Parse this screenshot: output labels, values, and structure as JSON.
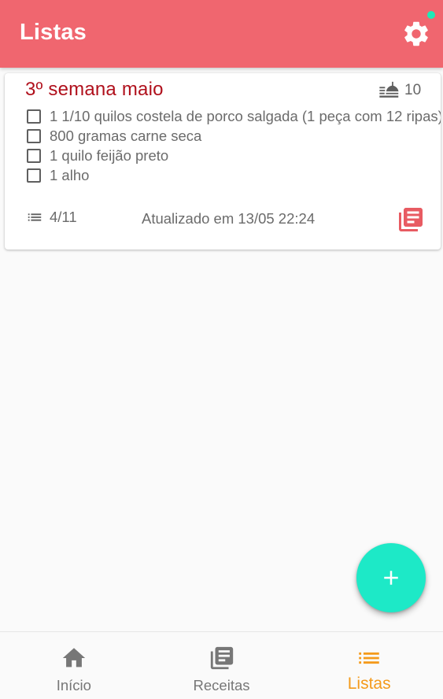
{
  "header": {
    "title": "Listas",
    "bg_color": "#f0666f",
    "settings_icon": "gear-icon"
  },
  "list_card": {
    "title": "3º semana maio",
    "title_color": "#b0101c",
    "servings_icon": "food-tray-icon",
    "servings": "10",
    "items": [
      {
        "text": "1 1/10 quilos costela de porco salgada (1 peça com 12 ripas)"
      },
      {
        "text": "800 gramas carne seca"
      },
      {
        "text": "1 quilo feijão preto"
      },
      {
        "text": "1 alho"
      }
    ],
    "progress_icon": "list-icon",
    "progress": "4/11",
    "updated": "Atualizado em 13/05 22:24",
    "recipe_icon": "recipe-book-icon",
    "accent_color": "#e85b62"
  },
  "fab": {
    "icon": "plus-icon",
    "color": "#1de9c7"
  },
  "bottom_nav": {
    "items": [
      {
        "label": "Início",
        "icon": "home-icon",
        "active": false
      },
      {
        "label": "Receitas",
        "icon": "recipe-book-icon",
        "active": false
      },
      {
        "label": "Listas",
        "icon": "list-icon",
        "active": true
      }
    ],
    "active_color": "#f49a1b",
    "inactive_color": "#777777"
  }
}
